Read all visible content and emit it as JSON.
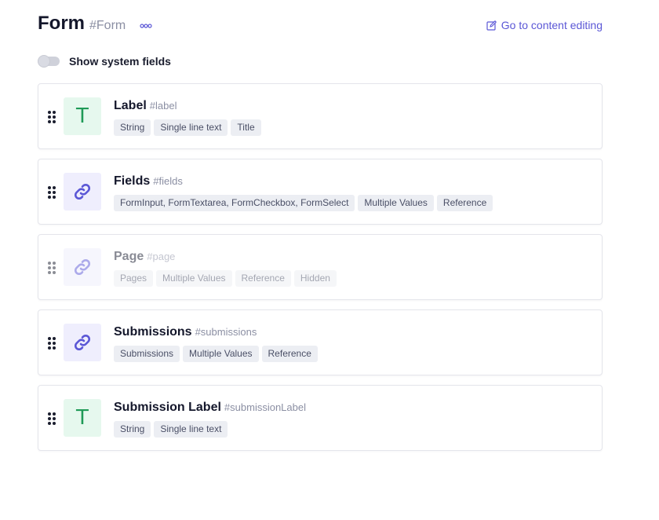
{
  "header": {
    "title": "Form",
    "api_id": "#Form",
    "more_icon": "more-horizontal-icon",
    "edit_link_label": "Go to content editing",
    "edit_icon": "edit-icon",
    "accent_color": "#5b57d6"
  },
  "toggle": {
    "label": "Show system fields",
    "state": "off"
  },
  "fields": [
    {
      "name": "Label",
      "key": "#label",
      "icon": "text-type-icon",
      "tags": [
        "String",
        "Single line text",
        "Title"
      ],
      "hidden": false
    },
    {
      "name": "Fields",
      "key": "#fields",
      "icon": "reference-link-icon",
      "tags": [
        "FormInput, FormTextarea, FormCheckbox, FormSelect",
        "Multiple Values",
        "Reference"
      ],
      "hidden": false
    },
    {
      "name": "Page",
      "key": "#page",
      "icon": "reference-link-icon",
      "tags": [
        "Pages",
        "Multiple Values",
        "Reference",
        "Hidden"
      ],
      "hidden": true
    },
    {
      "name": "Submissions",
      "key": "#submissions",
      "icon": "reference-link-icon",
      "tags": [
        "Submissions",
        "Multiple Values",
        "Reference"
      ],
      "hidden": false
    },
    {
      "name": "Submission Label",
      "key": "#submissionLabel",
      "icon": "text-type-icon",
      "tags": [
        "String",
        "Single line text"
      ],
      "hidden": false
    }
  ],
  "colors": {
    "text_icon_bg": "#e6f8ee",
    "text_icon_fg": "#1f9a57",
    "ref_icon_bg": "#efeefd",
    "ref_icon_fg": "#5b57d6",
    "tag_bg": "#eceef3"
  }
}
